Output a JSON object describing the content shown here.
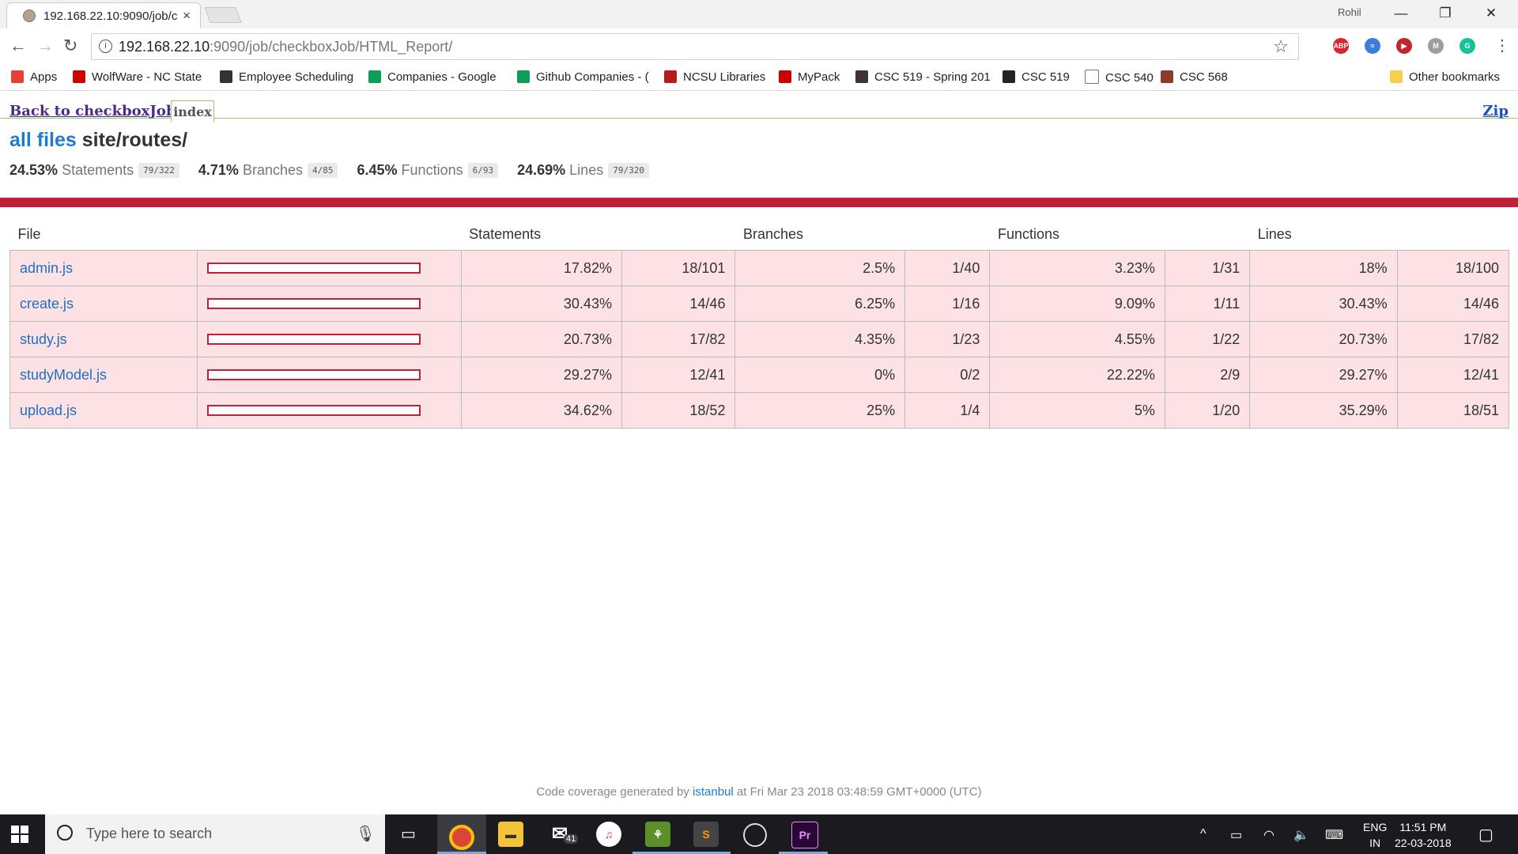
{
  "browser": {
    "tab_title": "192.168.22.10:9090/job/c",
    "tab_close": "×",
    "profile_name": "Rohil",
    "url_host": "192.168.22.10",
    "url_rest": ":9090/job/checkboxJob/HTML_Report/",
    "window_minimize": "—",
    "window_restore": "❐",
    "window_close": "✕",
    "extensions": [
      {
        "name": "abp-icon",
        "label": "ABP",
        "color": "#d9232e"
      },
      {
        "name": "sync-icon",
        "label": "≈",
        "color": "#3b7ddd"
      },
      {
        "name": "video-icon",
        "label": "▶",
        "color": "#c0272d"
      },
      {
        "name": "m-icon",
        "label": "M",
        "color": "#9e9e9e"
      },
      {
        "name": "grammarly-icon",
        "label": "G",
        "color": "#15c39a"
      }
    ]
  },
  "bookmarks": [
    {
      "label": "Apps",
      "icon": "apps-grid-icon",
      "color": "#e34234"
    },
    {
      "label": "WolfWare - NC State",
      "icon": "wolfware-icon",
      "color": "#cc0000"
    },
    {
      "label": "Employee Scheduling",
      "icon": "w-icon",
      "color": "#333333"
    },
    {
      "label": "Companies - Google",
      "icon": "sheets-icon",
      "color": "#0f9d58"
    },
    {
      "label": "Github Companies - (",
      "icon": "sheets-icon",
      "color": "#0f9d58"
    },
    {
      "label": "NCSU Libraries",
      "icon": "libraries-icon",
      "color": "#b71c1c"
    },
    {
      "label": "MyPack",
      "icon": "mypack-icon",
      "color": "#cc0000"
    },
    {
      "label": "CSC 519 - Spring 201",
      "icon": "slack-icon",
      "color": "#3e313c"
    },
    {
      "label": "CSC 519",
      "icon": "github-icon",
      "color": "#222222"
    },
    {
      "label": "CSC 540",
      "icon": "page-icon",
      "color": "#ffffff"
    },
    {
      "label": "CSC 568",
      "icon": "avatar-icon",
      "color": "#8d3a2a"
    }
  ],
  "other_bookmarks": "Other bookmarks",
  "report": {
    "back_link": "Back to checkboxJob",
    "index_tab": "index",
    "zip_link": "Zip",
    "all_files": "all files",
    "path": "site/routes/",
    "summary": [
      {
        "pct": "24.53%",
        "label": "Statements",
        "frac": "79/322"
      },
      {
        "pct": "4.71%",
        "label": "Branches",
        "frac": "4/85"
      },
      {
        "pct": "6.45%",
        "label": "Functions",
        "frac": "6/93"
      },
      {
        "pct": "24.69%",
        "label": "Lines",
        "frac": "79/320"
      }
    ],
    "headers": {
      "file": "File",
      "statements": "Statements",
      "branches": "Branches",
      "functions": "Functions",
      "lines": "Lines"
    },
    "rows": [
      {
        "file": "admin.js",
        "cov": 0.1782,
        "st_pct": "17.82%",
        "st_frac": "18/101",
        "br_pct": "2.5%",
        "br_frac": "1/40",
        "fn_pct": "3.23%",
        "fn_frac": "1/31",
        "ln_pct": "18%",
        "ln_frac": "18/100"
      },
      {
        "file": "create.js",
        "cov": 0.3043,
        "st_pct": "30.43%",
        "st_frac": "14/46",
        "br_pct": "6.25%",
        "br_frac": "1/16",
        "fn_pct": "9.09%",
        "fn_frac": "1/11",
        "ln_pct": "30.43%",
        "ln_frac": "14/46"
      },
      {
        "file": "study.js",
        "cov": 0.2073,
        "st_pct": "20.73%",
        "st_frac": "17/82",
        "br_pct": "4.35%",
        "br_frac": "1/23",
        "fn_pct": "4.55%",
        "fn_frac": "1/22",
        "ln_pct": "20.73%",
        "ln_frac": "17/82"
      },
      {
        "file": "studyModel.js",
        "cov": 0.2927,
        "st_pct": "29.27%",
        "st_frac": "12/41",
        "br_pct": "0%",
        "br_frac": "0/2",
        "fn_pct": "22.22%",
        "fn_frac": "2/9",
        "ln_pct": "29.27%",
        "ln_frac": "12/41"
      },
      {
        "file": "upload.js",
        "cov": 0.3462,
        "st_pct": "34.62%",
        "st_frac": "18/52",
        "br_pct": "25%",
        "br_frac": "1/4",
        "fn_pct": "5%",
        "fn_frac": "1/20",
        "ln_pct": "35.29%",
        "ln_frac": "18/51"
      }
    ],
    "footer_prefix": "Code coverage generated by",
    "footer_link": "istanbul",
    "footer_suffix": "at Fri Mar 23 2018 03:48:59 GMT+0000 (UTC)"
  },
  "taskbar": {
    "search_placeholder": "Type here to search",
    "mail_badge": "41",
    "lang_line1": "ENG",
    "lang_line2": "IN",
    "time": "11:51 PM",
    "date": "22-03-2018"
  },
  "colors": {
    "red": "#c21f39",
    "row_bg": "#fce1e5",
    "link": "#1f7bd0"
  }
}
